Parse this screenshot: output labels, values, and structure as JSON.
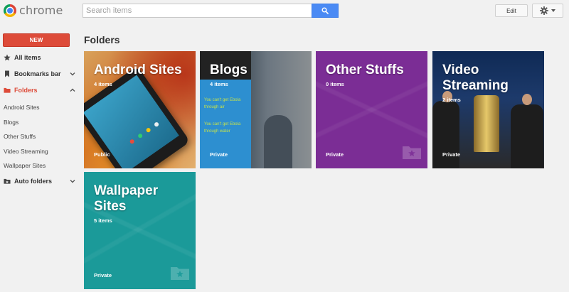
{
  "app": {
    "name": "chrome"
  },
  "search": {
    "placeholder": "Search items"
  },
  "toolbar": {
    "edit_label": "Edit"
  },
  "sidebar": {
    "new_label": "NEW",
    "all_items": "All items",
    "bookmarks_bar": "Bookmarks bar",
    "folders": "Folders",
    "subfolders": [
      "Android Sites",
      "Blogs",
      "Other Stuffs",
      "Video Streaming",
      "Wallpaper Sites"
    ],
    "auto_folders": "Auto folders"
  },
  "main": {
    "title": "Folders",
    "tiles": [
      {
        "name": "Android Sites",
        "count": "4 items",
        "privacy": "Public"
      },
      {
        "name": "Blogs",
        "count": "4 items",
        "privacy": "Private"
      },
      {
        "name": "Other Stuffs",
        "count": "0 items",
        "privacy": "Private"
      },
      {
        "name": "Video Streaming",
        "count": "2 items",
        "privacy": "Private"
      },
      {
        "name": "Wallpaper Sites",
        "count": "5 items",
        "privacy": "Private"
      }
    ]
  },
  "colors": {
    "accent_red": "#dd4b39",
    "search_blue": "#4a8af4",
    "purple_tile": "#7b2d95",
    "teal_tile": "#1b9a99"
  },
  "icons": [
    "search-icon",
    "gear-icon",
    "star-icon",
    "bookmark-icon",
    "folder-icon",
    "chevron-down-icon",
    "chevron-up-icon",
    "folder-star-icon"
  ]
}
